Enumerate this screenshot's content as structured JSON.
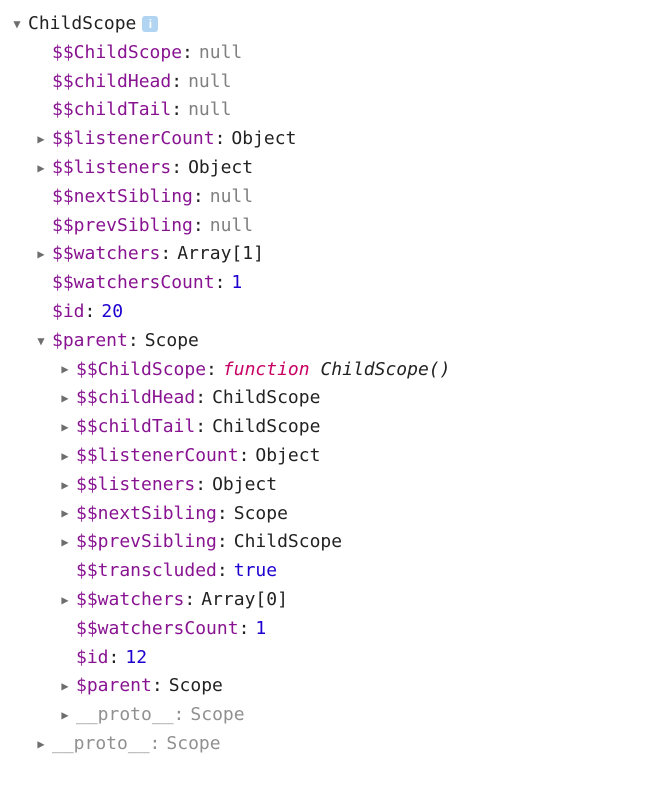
{
  "root": {
    "name": "ChildScope",
    "chev": "▼"
  },
  "l1": {
    "chev_right": "▶",
    "chev_down": "▼",
    "childscope": {
      "name": "$$ChildScope",
      "value": "null",
      "type": "null"
    },
    "childhead": {
      "name": "$$childHead",
      "value": "null",
      "type": "null"
    },
    "childtail": {
      "name": "$$childTail",
      "value": "null",
      "type": "null"
    },
    "listenercount": {
      "name": "$$listenerCount",
      "value": "Object",
      "type": "obj"
    },
    "listeners": {
      "name": "$$listeners",
      "value": "Object",
      "type": "obj"
    },
    "nextsibling": {
      "name": "$$nextSibling",
      "value": "null",
      "type": "null"
    },
    "prevsibling": {
      "name": "$$prevSibling",
      "value": "null",
      "type": "null"
    },
    "watchers": {
      "name": "$$watchers",
      "value": "Array[1]",
      "type": "obj"
    },
    "watcherscount": {
      "name": "$$watchersCount",
      "value": "1",
      "type": "num"
    },
    "id": {
      "name": "$id",
      "value": "20",
      "type": "num"
    },
    "parent": {
      "name": "$parent",
      "value": "Scope",
      "type": "obj"
    },
    "proto": {
      "name": "__proto__",
      "value": "Scope",
      "type": "obj"
    }
  },
  "l2": {
    "childscope": {
      "name": "$$ChildScope",
      "value": "ChildScope()",
      "kw": "function",
      "type": "func"
    },
    "childhead": {
      "name": "$$childHead",
      "value": "ChildScope",
      "type": "obj"
    },
    "childtail": {
      "name": "$$childTail",
      "value": "ChildScope",
      "type": "obj"
    },
    "listenercount": {
      "name": "$$listenerCount",
      "value": "Object",
      "type": "obj"
    },
    "listeners": {
      "name": "$$listeners",
      "value": "Object",
      "type": "obj"
    },
    "nextsibling": {
      "name": "$$nextSibling",
      "value": "Scope",
      "type": "obj"
    },
    "prevsibling": {
      "name": "$$prevSibling",
      "value": "ChildScope",
      "type": "obj"
    },
    "transcluded": {
      "name": "$$transcluded",
      "value": "true",
      "type": "bool"
    },
    "watchers": {
      "name": "$$watchers",
      "value": "Array[0]",
      "type": "obj"
    },
    "watcherscount": {
      "name": "$$watchersCount",
      "value": "1",
      "type": "num"
    },
    "id": {
      "name": "$id",
      "value": "12",
      "type": "num"
    },
    "parent": {
      "name": "$parent",
      "value": "Scope",
      "type": "obj"
    },
    "proto": {
      "name": "__proto__",
      "value": "Scope",
      "type": "obj"
    }
  },
  "info_badge": "i"
}
